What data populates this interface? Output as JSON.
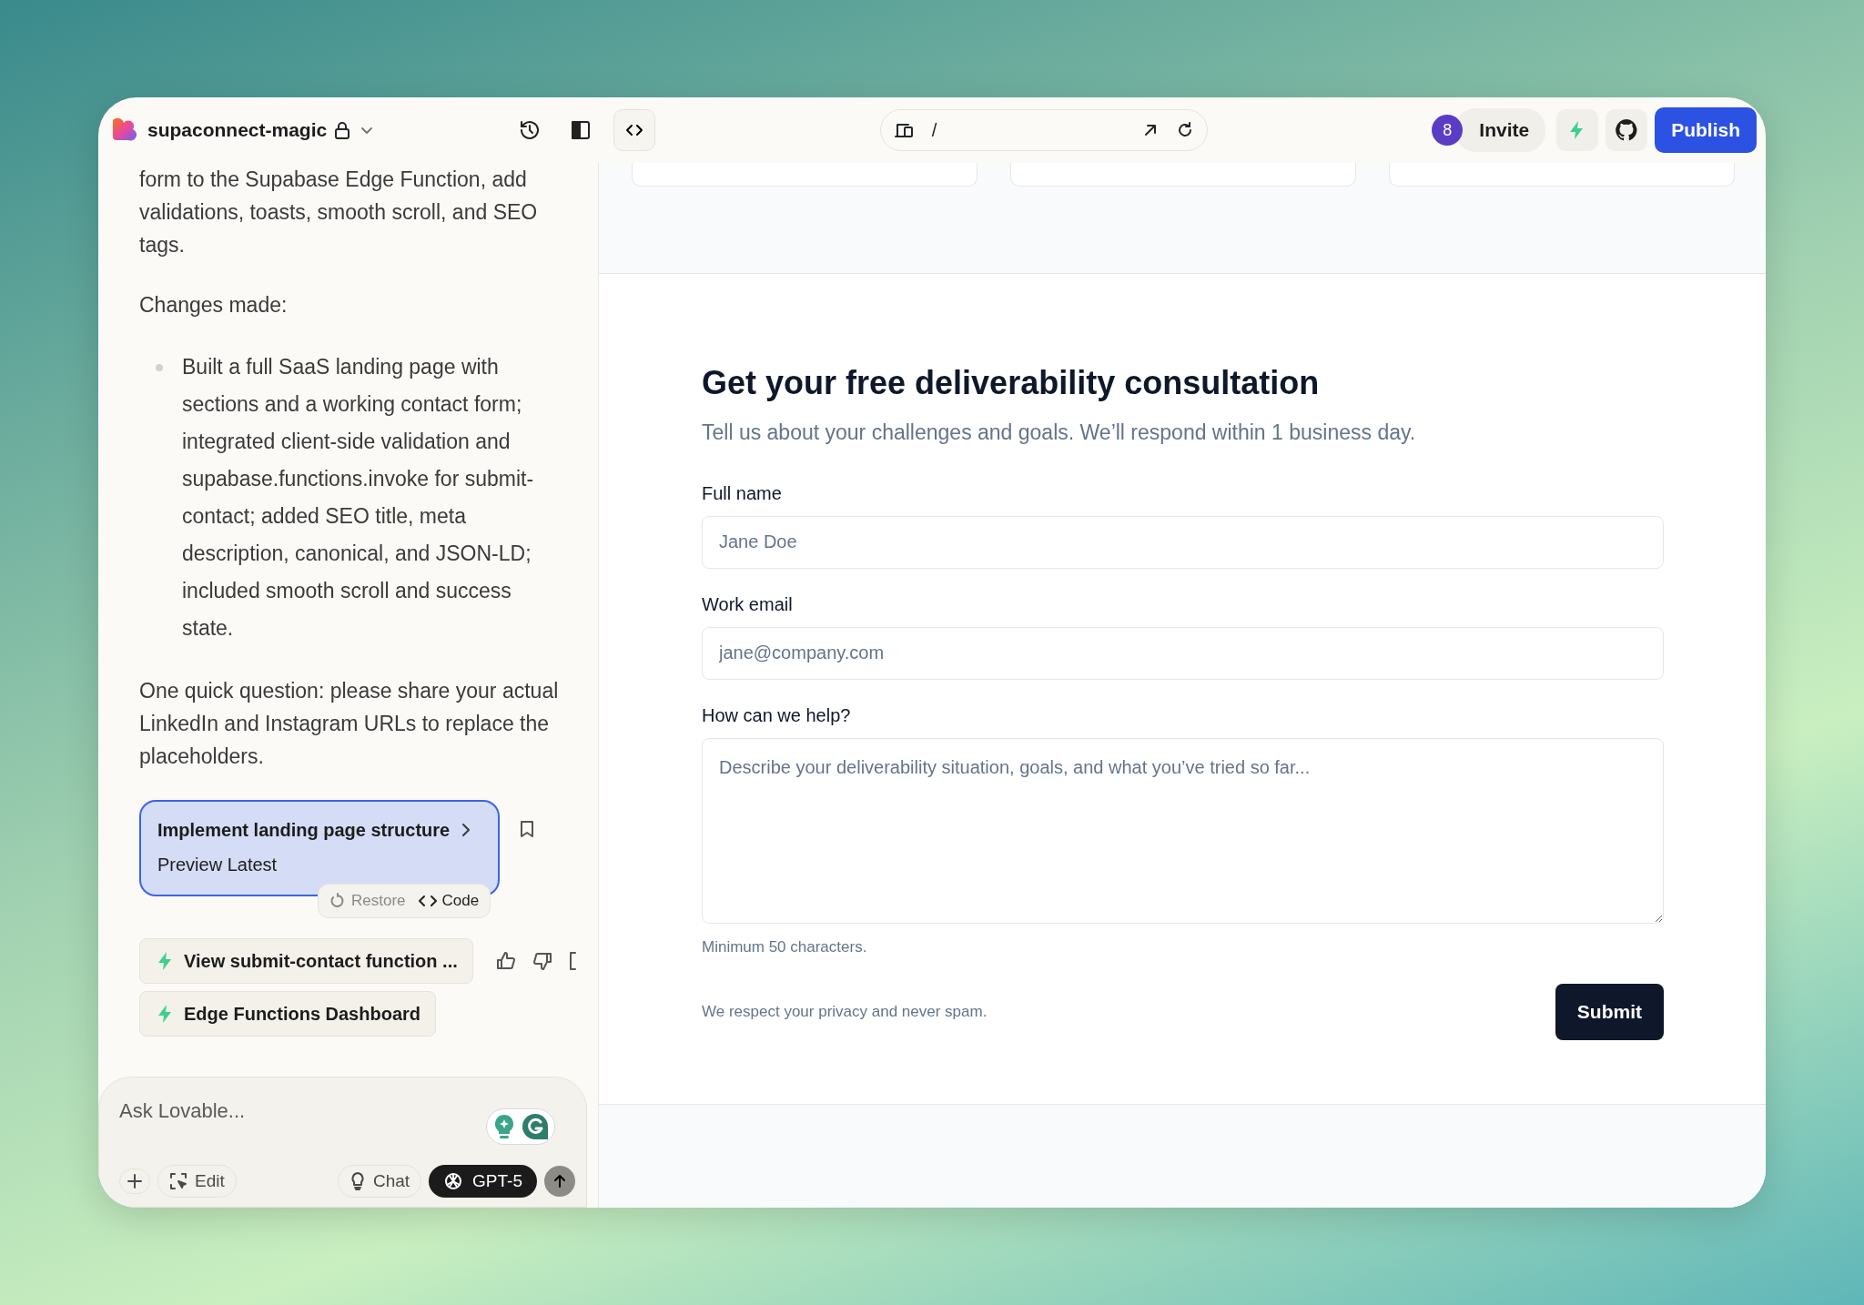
{
  "project": {
    "name": "supaconnect-magic"
  },
  "address": {
    "path": "/"
  },
  "collaborators": {
    "count": "8"
  },
  "header_buttons": [
    {
      "kind": "invite",
      "label": "Invite"
    },
    {
      "kind": "publish",
      "label": "Publish"
    }
  ],
  "chat": {
    "blocks": [
      {
        "kind": "paragraph",
        "text": "form to the Supabase Edge Function, add validations, toasts, smooth scroll, and SEO tags."
      },
      {
        "kind": "paragraph",
        "text": "Changes made:"
      },
      {
        "kind": "bullets",
        "items": [
          "Built a full SaaS landing page with sections and a working contact form; integrated client-side validation and supabase.functions.invoke for submit-contact; added SEO title, meta description, canonical, and JSON-LD; included smooth scroll and success state."
        ]
      },
      {
        "kind": "paragraph",
        "text": "One quick question: please share your actual LinkedIn and Instagram URLs to replace the placeholders."
      }
    ],
    "version_card": {
      "title": "Implement landing page structure",
      "subtitle": "Preview Latest",
      "actions": [
        {
          "kind": "restore",
          "label": "Restore",
          "disabled": true
        },
        {
          "kind": "code",
          "label": "Code",
          "disabled": false
        }
      ]
    },
    "links": [
      "View submit-contact function ...",
      "Edge Functions Dashboard"
    ]
  },
  "composer": {
    "placeholder": "Ask Lovable...",
    "edit_label": "Edit",
    "chat_label": "Chat",
    "model": "GPT-5"
  },
  "preview": {
    "heading": "Get your free deliverability consultation",
    "subtitle": "Tell us about your challenges and goals. We’ll respond within 1 business day.",
    "fields": [
      {
        "kind": "input",
        "label": "Full name",
        "placeholder": "Jane Doe"
      },
      {
        "kind": "input",
        "label": "Work email",
        "placeholder": "jane@company.com"
      },
      {
        "kind": "textarea",
        "label": "How can we help?",
        "placeholder": "Describe your deliverability situation, goals, and what you’ve tried so far...",
        "hint": "Minimum 50 characters."
      }
    ],
    "privacy_note": "We respect your privacy and never spam.",
    "submit": "Submit"
  }
}
